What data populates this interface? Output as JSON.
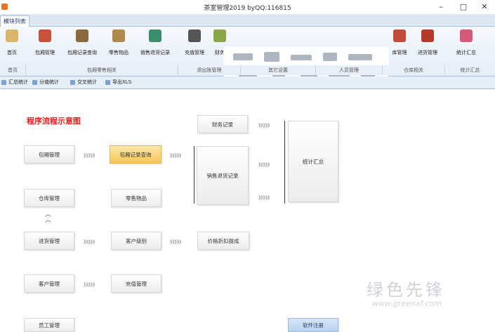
{
  "window": {
    "title": "茶室管理2019 byQQ:116815",
    "min": "–",
    "max": "□",
    "close": "✕"
  },
  "tabs": [
    {
      "label": "模块列表"
    }
  ],
  "ribbon": {
    "buttons": [
      {
        "label": "首页",
        "color": "#d9b66a"
      },
      {
        "label": "包厢管理",
        "color": "#c9523f"
      },
      {
        "label": "包厢记录查询",
        "color": "#8a6a3d"
      },
      {
        "label": "零售物品",
        "color": "#b08a4a"
      },
      {
        "label": "销售退货记录",
        "color": "#3c8d6b"
      },
      {
        "label": "充值管理",
        "color": "#555555"
      },
      {
        "label": "财务",
        "color": "#8aa64a"
      },
      {
        "label": "库管理",
        "color": "#c44b3a"
      },
      {
        "label": "进货管理",
        "color": "#b53a2a"
      },
      {
        "label": "统计汇总",
        "color": "#d55a7a"
      }
    ],
    "groups": [
      {
        "label": "首页"
      },
      {
        "label": "包厢零售相关"
      },
      {
        "label": "退出账管理"
      },
      {
        "label": "其它设置"
      },
      {
        "label": "人员管理"
      },
      {
        "label": "仓库相关"
      },
      {
        "label": "统计汇总"
      }
    ]
  },
  "toolbar": {
    "items": [
      {
        "label": "汇总统计"
      },
      {
        "label": "分值统计"
      },
      {
        "label": "交叉统计"
      },
      {
        "label": "导出XLS"
      }
    ]
  },
  "flow": {
    "title": "程序流程示意图",
    "arrow": "》》》》》",
    "up": "︿",
    "nodes": {
      "baoxiang": "包厢管理",
      "baoxiang_query": "包厢记录查询",
      "finance": "财务记录",
      "sales_return": "销售退货记录",
      "stats": "统计汇总",
      "warehouse": "仓库管理",
      "retail": "零售物品",
      "purchase": "进货管理",
      "customer_level": "客户级别",
      "price_discount": "价格折扣提成",
      "customer": "客户管理",
      "recharge": "充值管理",
      "staff": "员工管理",
      "register": "软件注册"
    }
  },
  "watermark": {
    "text": "绿色先锋",
    "url": "www.greenxf.com"
  }
}
